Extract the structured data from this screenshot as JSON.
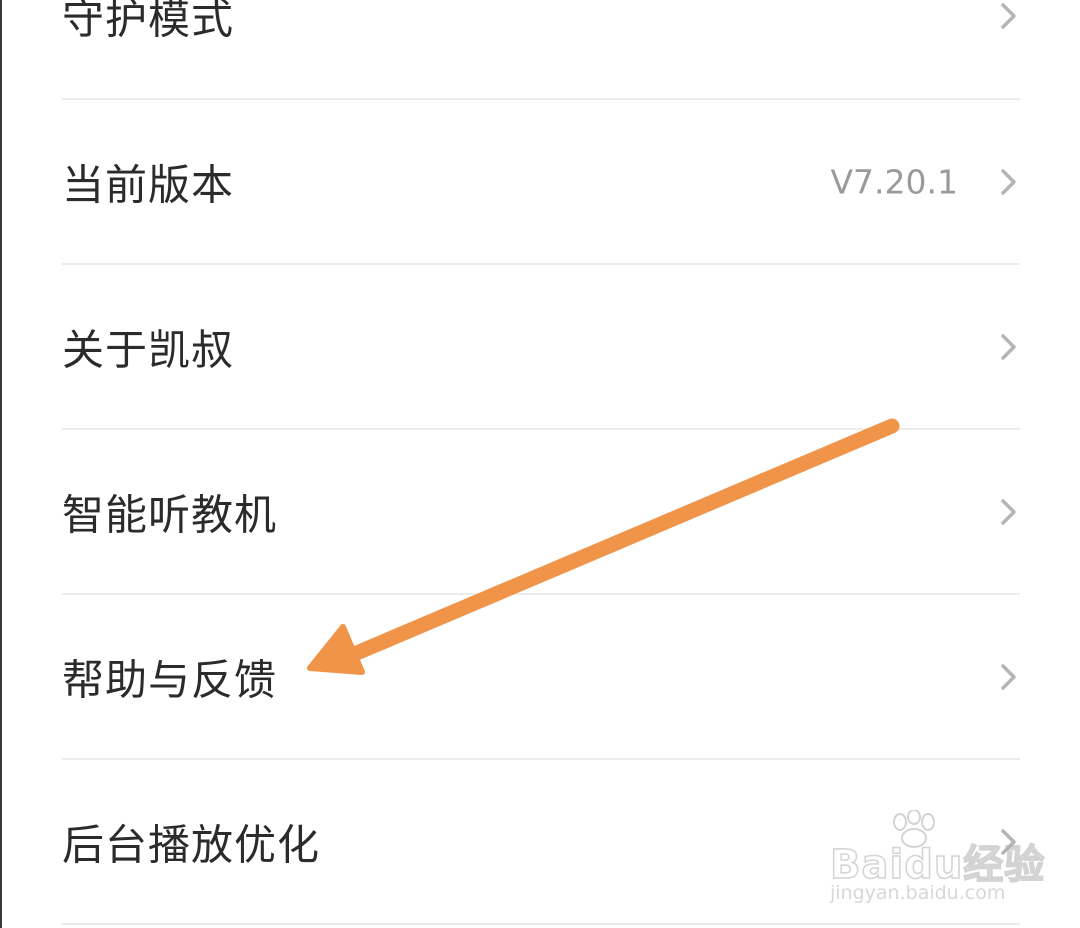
{
  "settings": {
    "items": [
      {
        "label": "守护模式",
        "value": ""
      },
      {
        "label": "当前版本",
        "value": "V7.20.1"
      },
      {
        "label": "关于凯叔",
        "value": ""
      },
      {
        "label": "智能听教机",
        "value": ""
      },
      {
        "label": "帮助与反馈",
        "value": ""
      },
      {
        "label": "后台播放优化",
        "value": ""
      }
    ]
  },
  "watermark": {
    "brand": "Baidu经验",
    "url": "jingyan.baidu.com"
  },
  "colors": {
    "annotation_arrow": "#F0944A",
    "label_text": "#2B2B2B",
    "value_text": "#9A9A9A",
    "chevron": "#B5B5B5",
    "divider": "#ECECEC"
  },
  "icons": {
    "row_chevron": "chevron-right-icon",
    "annotation": "arrow-annotation-icon"
  }
}
